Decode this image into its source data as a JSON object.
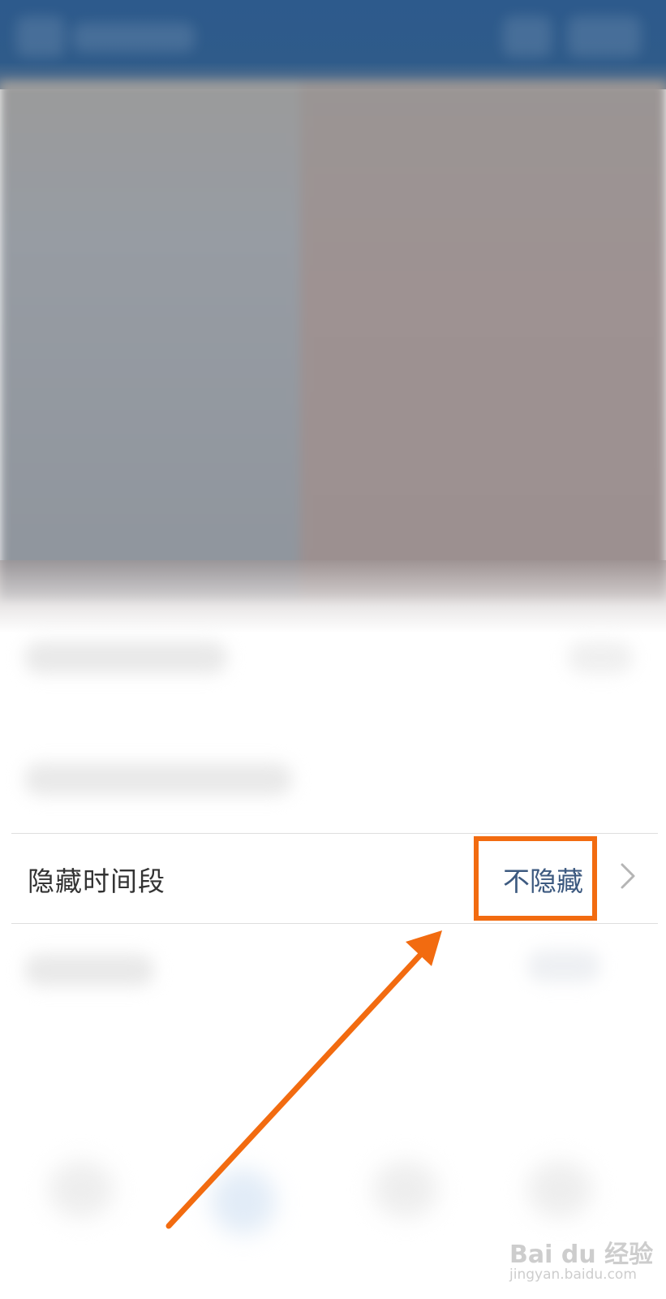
{
  "setting_row": {
    "label": "隐藏时间段",
    "value": "不隐藏"
  },
  "icons": {
    "chevron": "chevron-right-icon"
  },
  "annotation": {
    "color": "#f26b10"
  },
  "watermark": {
    "brand": "Bai du 经验",
    "url": "jingyan.baidu.com"
  },
  "colors": {
    "header": "#2d5a8c",
    "value_text": "#3d5a80",
    "label_text": "#333333"
  }
}
